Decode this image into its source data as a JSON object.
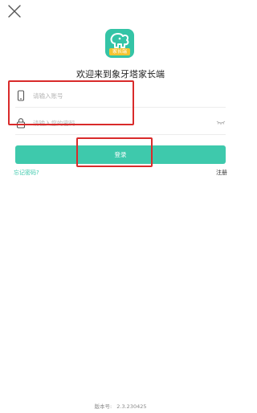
{
  "header": {
    "close_icon": "close-icon"
  },
  "logo": {
    "tag_text": "家长端"
  },
  "welcome": "欢迎来到象牙塔家长端",
  "account": {
    "icon": "phone-icon",
    "placeholder": "请输入账号"
  },
  "password": {
    "icon": "lock-icon",
    "placeholder": "请输入您的密码",
    "toggle_icon": "eye-closed-icon"
  },
  "login_button": "登录",
  "forgot_password": "忘记密码?",
  "register": "注册",
  "version": {
    "label": "版本号:",
    "value": "2.3.230425"
  },
  "colors": {
    "accent": "#3ec9ac",
    "highlight": "#d92b2b",
    "logo_bg": "#34c4a6",
    "logo_tag": "#f4c430"
  }
}
